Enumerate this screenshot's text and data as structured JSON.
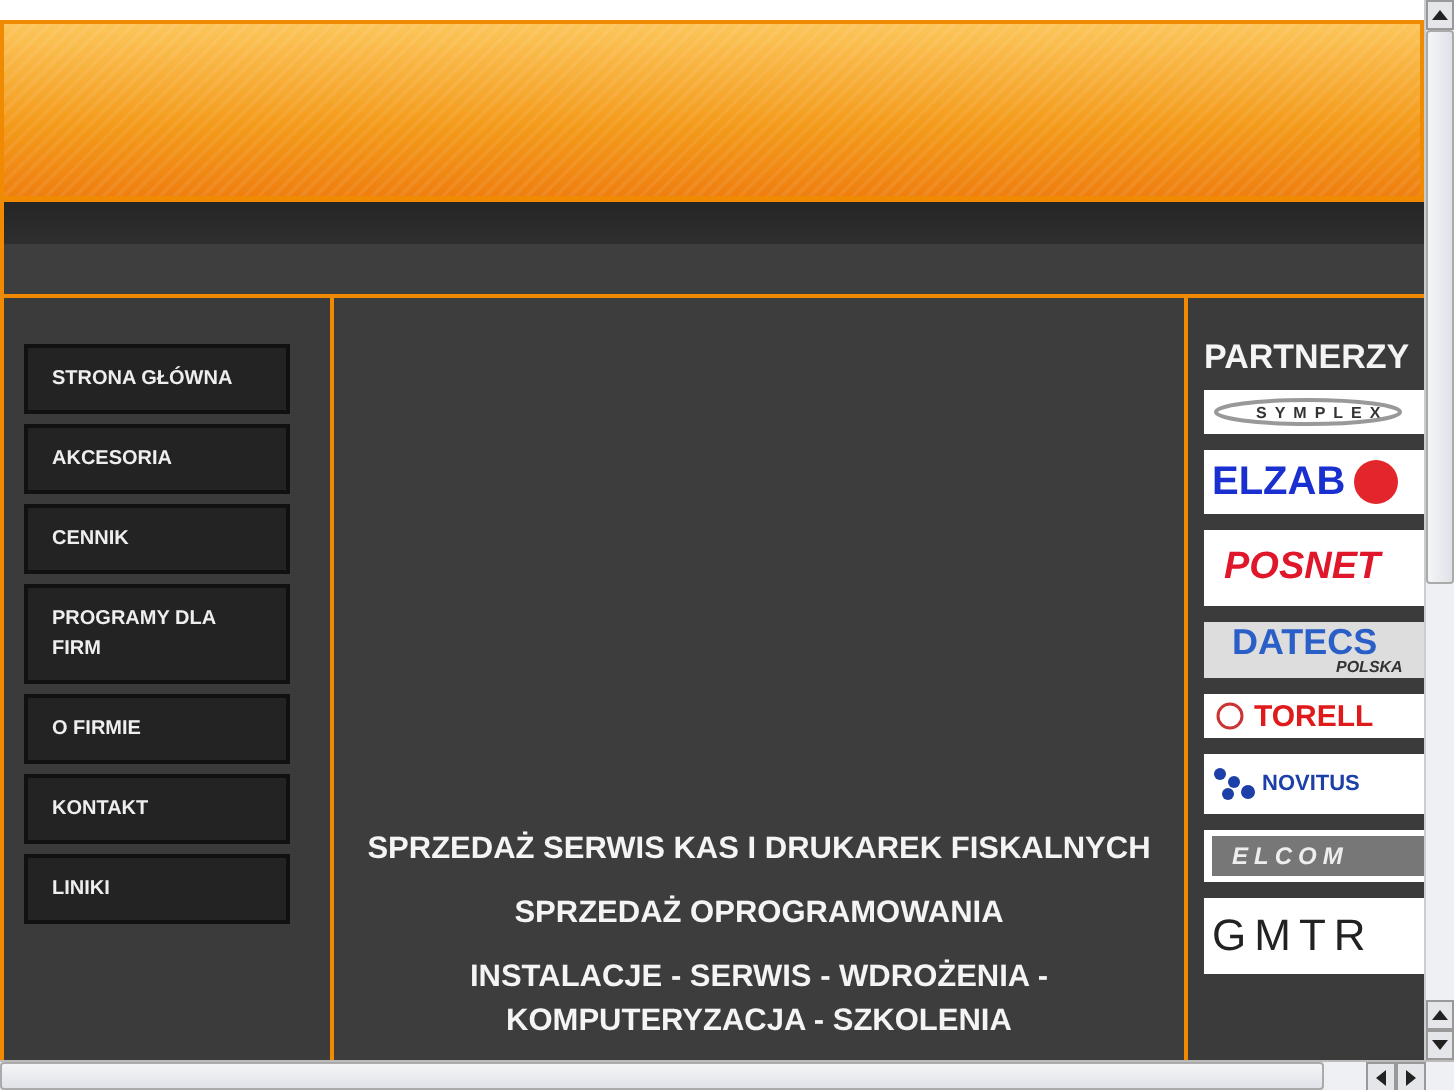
{
  "menu": [
    {
      "label": "STRONA GŁÓWNA"
    },
    {
      "label": "AKCESORIA"
    },
    {
      "label": "CENNIK"
    },
    {
      "label": "PROGRAMY DLA FIRM"
    },
    {
      "label": "O FIRMIE"
    },
    {
      "label": "KONTAKT"
    },
    {
      "label": "LINIKI"
    }
  ],
  "headlines": [
    "SPRZEDAŻ SERWIS KAS I DRUKAREK FISKALNYCH",
    "SPRZEDAŻ OPROGRAMOWANIA",
    "INSTALACJE - SERWIS - WDROŻENIA - KOMPUTERYZACJA - SZKOLENIA"
  ],
  "partners": {
    "title": "PARTNERZY",
    "logos": [
      {
        "kind": "symplex",
        "text": "SYMPLEX"
      },
      {
        "kind": "elzab",
        "text": "ELZAB"
      },
      {
        "kind": "posnet",
        "text": "POSNET"
      },
      {
        "kind": "datecs",
        "text": "DATECS",
        "subtext": "POLSKA"
      },
      {
        "kind": "torell",
        "text": "TORELL"
      },
      {
        "kind": "novitus",
        "text": "NOVITUS"
      },
      {
        "kind": "elcom",
        "text": "ELCOM"
      },
      {
        "kind": "gmtr",
        "text": "GMTR"
      }
    ]
  }
}
